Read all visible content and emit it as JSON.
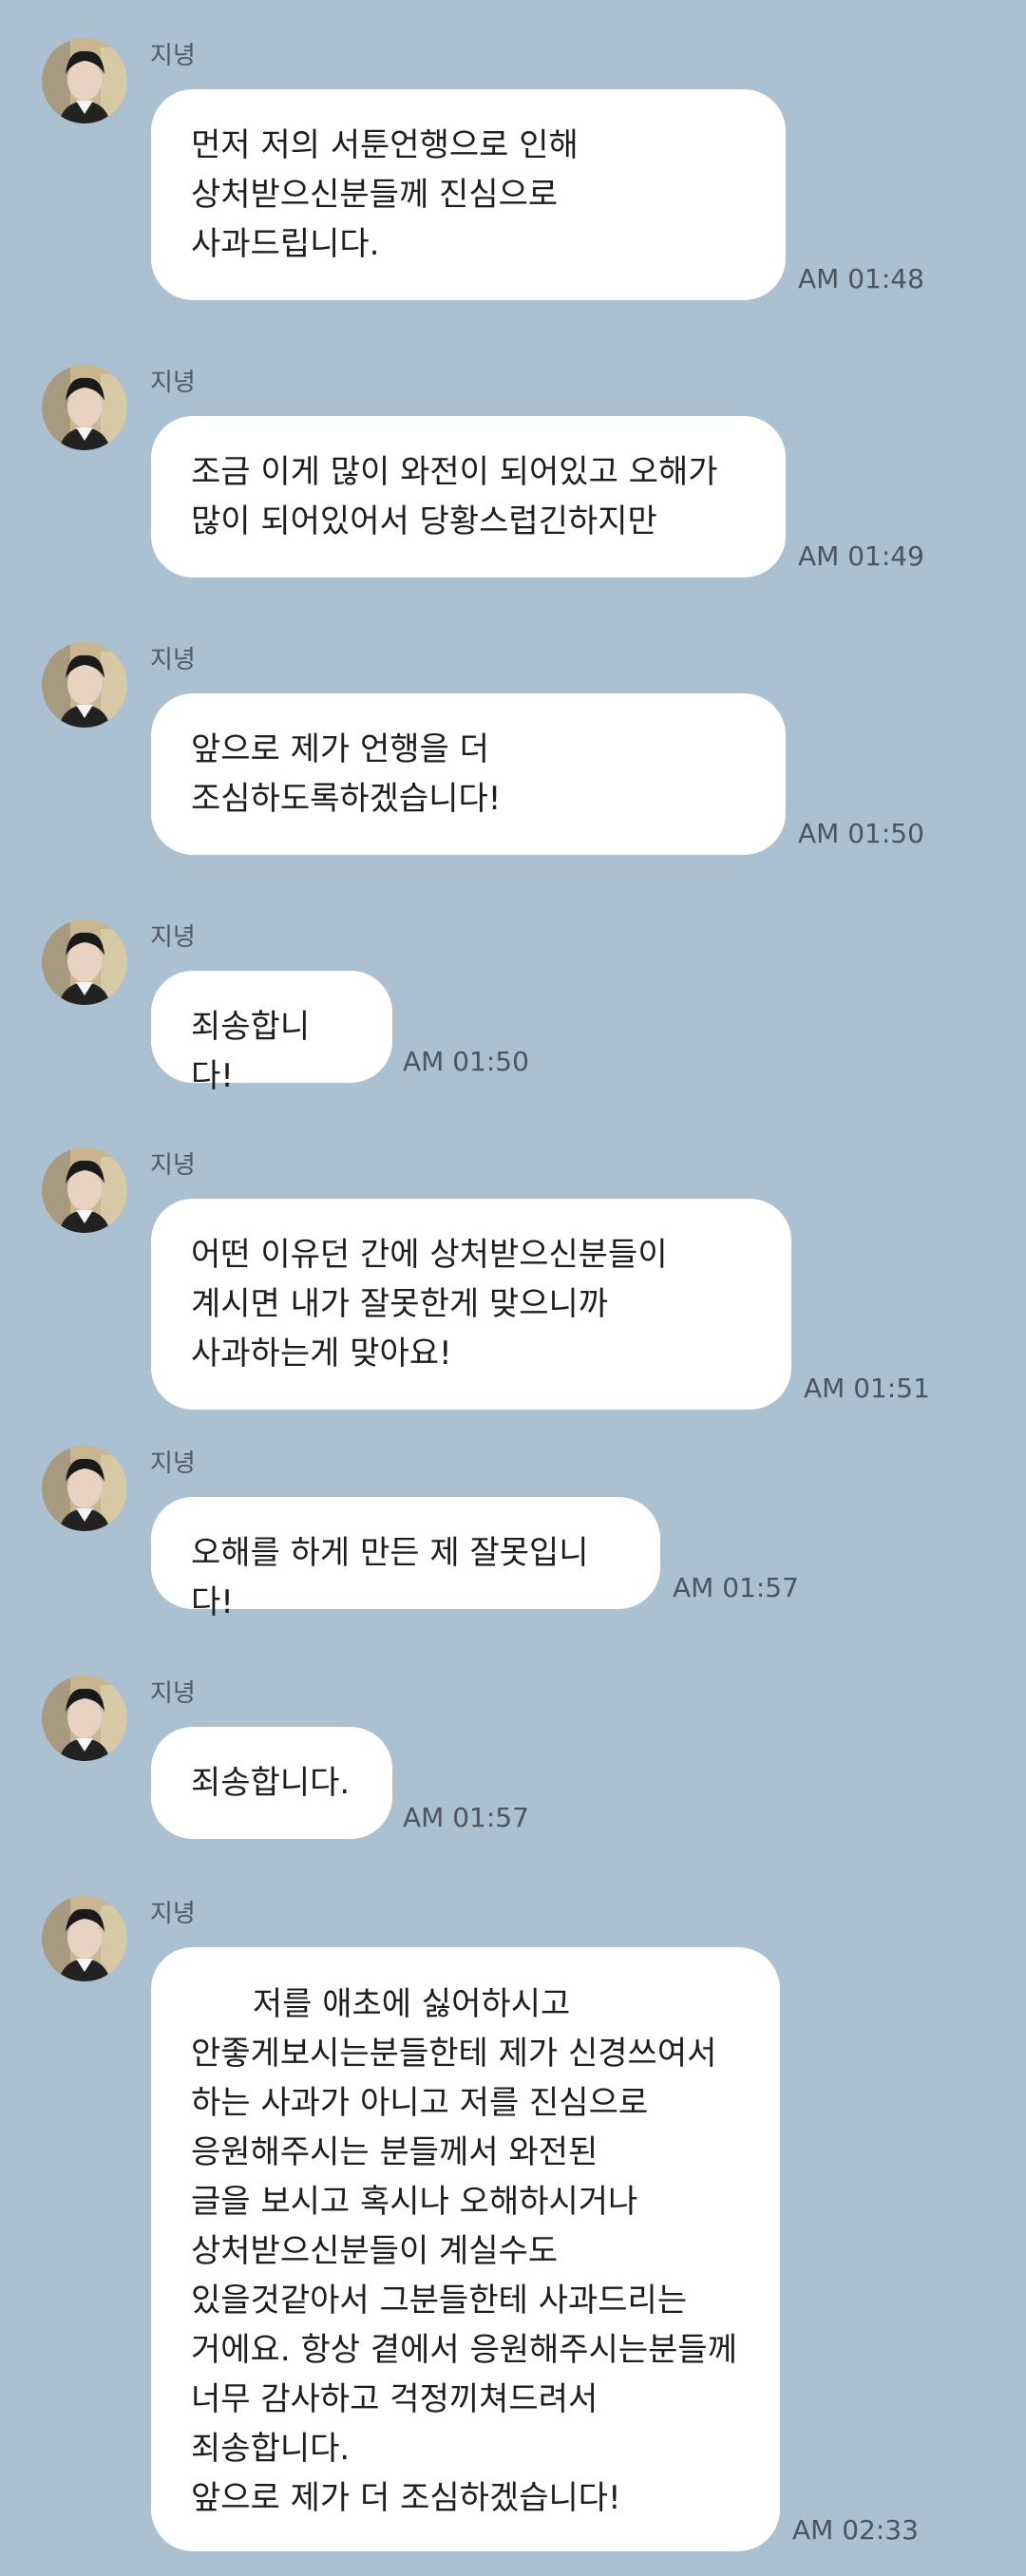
{
  "messages": [
    {
      "sender": "지녕",
      "text": "먼저 저의 서툰언행으로 인해\n상처받으신분들께 진심으로\n사과드립니다.",
      "time": "AM 01:48"
    },
    {
      "sender": "지녕",
      "text": "조금 이게 많이 와전이 되어있고 오해가\n많이 되어있어서 당황스럽긴하지만",
      "time": "AM 01:49"
    },
    {
      "sender": "지녕",
      "text": "앞으로 제가 언행을 더\n조심하도록하겠습니다!",
      "time": "AM 01:50"
    },
    {
      "sender": "지녕",
      "text": "죄송합니다!",
      "time": "AM 01:50"
    },
    {
      "sender": "지녕",
      "text": "어떤 이유던 간에 상처받으신분들이\n계시면 내가 잘못한게 맞으니까\n사과하는게 맞아요!",
      "time": "AM 01:51"
    },
    {
      "sender": "지녕",
      "text": "오해를 하게 만든 제 잘못입니다!",
      "time": "AM 01:57"
    },
    {
      "sender": "지녕",
      "text": "죄송합니다.",
      "time": "AM 01:57"
    },
    {
      "sender": "지녕",
      "text": "      저를 애초에 싫어하시고\n안좋게보시는분들한테 제가 신경쓰여서\n하는 사과가 아니고 저를 진심으로\n응원해주시는 분들께서 와전된\n글을 보시고 혹시나 오해하시거나\n상처받으신분들이 계실수도\n있을것같아서 그분들한테 사과드리는\n거에요. 항상 곁에서 응원해주시는분들께\n너무 감사하고 걱정끼쳐드려서\n죄송합니다.\n앞으로 제가 더 조심하겠습니다!",
      "time": "AM 02:33"
    }
  ]
}
